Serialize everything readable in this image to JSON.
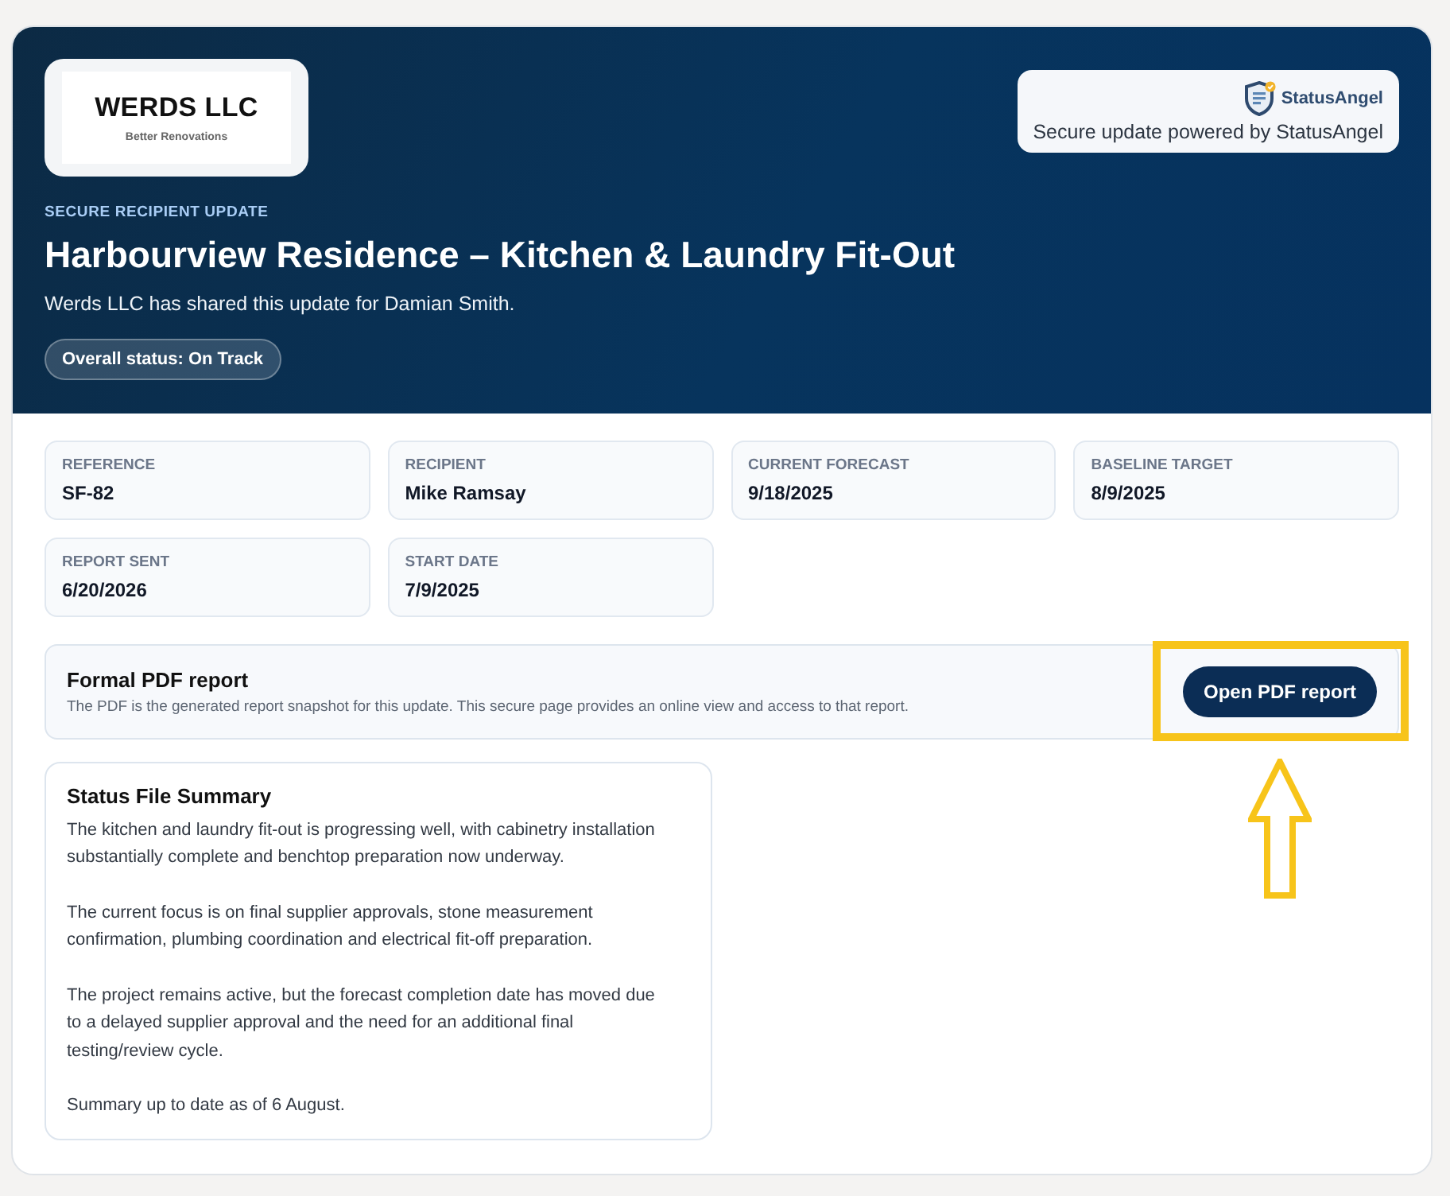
{
  "header": {
    "company_logo": {
      "name": "WERDS LLC",
      "tagline": "Better Renovations"
    },
    "provider_badge": {
      "brand": "StatusAngel",
      "caption": "Secure update powered by StatusAngel"
    },
    "eyebrow": "SECURE RECIPIENT UPDATE",
    "title": "Harbourview Residence – Kitchen & Laundry Fit-Out",
    "subtitle": "Werds LLC has shared this update for Damian Smith.",
    "status_pill": "Overall status: On Track"
  },
  "details": [
    {
      "label": "REFERENCE",
      "value": "SF-82"
    },
    {
      "label": "RECIPIENT",
      "value": "Mike Ramsay"
    },
    {
      "label": "CURRENT FORECAST",
      "value": "9/18/2025"
    },
    {
      "label": "BASELINE TARGET",
      "value": "8/9/2025"
    },
    {
      "label": "REPORT SENT",
      "value": "6/20/2026"
    },
    {
      "label": "START DATE",
      "value": "7/9/2025"
    }
  ],
  "pdf_report": {
    "title": "Formal PDF report",
    "description": "The PDF is the generated report snapshot for this update. This secure page provides an online view and access to that report.",
    "button": "Open PDF report",
    "highlighted": true
  },
  "summary": {
    "title": "Status File Summary",
    "paragraphs": [
      "The kitchen and laundry fit-out is progressing well, with cabinetry installation substantially complete and benchtop preparation now underway.",
      "The current focus is on final supplier approvals, stone measurement confirmation, plumbing coordination and electrical fit-off preparation.",
      "The project remains active, but the forecast completion date has moved due to a delayed supplier approval and the need for an additional final testing/review cycle.",
      "Summary up to date as of 6 August."
    ]
  }
}
